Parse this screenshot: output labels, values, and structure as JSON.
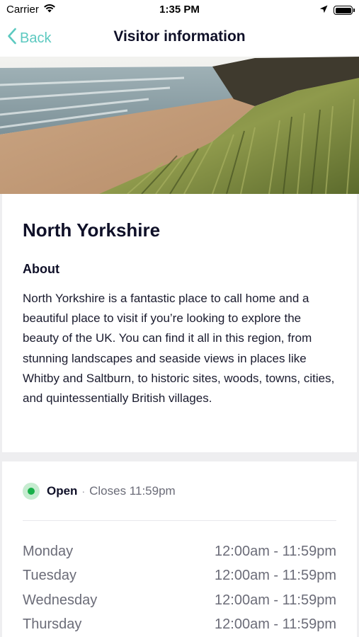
{
  "status_bar": {
    "carrier": "Carrier",
    "time": "1:35 PM"
  },
  "nav": {
    "back_label": "Back",
    "title": "Visitor information",
    "accent_color": "#5cc9c0"
  },
  "hero": {
    "image": "coastal-beach-cliff-grass-photo"
  },
  "place": {
    "title": "North Yorkshire",
    "about_heading": "About",
    "about_text": "North Yorkshire is a fantastic place to call home and a beautiful place to visit if you’re looking to explore the beauty of the UK. You can find it all in this region, from stunning landscapes and seaside views in places like Whitby and Saltburn, to historic sites, woods, towns, cities, and quintessentially British villages."
  },
  "hours": {
    "status": "Open",
    "status_color": "#19b04a",
    "separator": "·",
    "closes": "Closes 11:59pm",
    "days": [
      {
        "day": "Monday",
        "time": "12:00am - 11:59pm"
      },
      {
        "day": "Tuesday",
        "time": "12:00am - 11:59pm"
      },
      {
        "day": "Wednesday",
        "time": "12:00am - 11:59pm"
      },
      {
        "day": "Thursday",
        "time": "12:00am - 11:59pm"
      }
    ]
  }
}
